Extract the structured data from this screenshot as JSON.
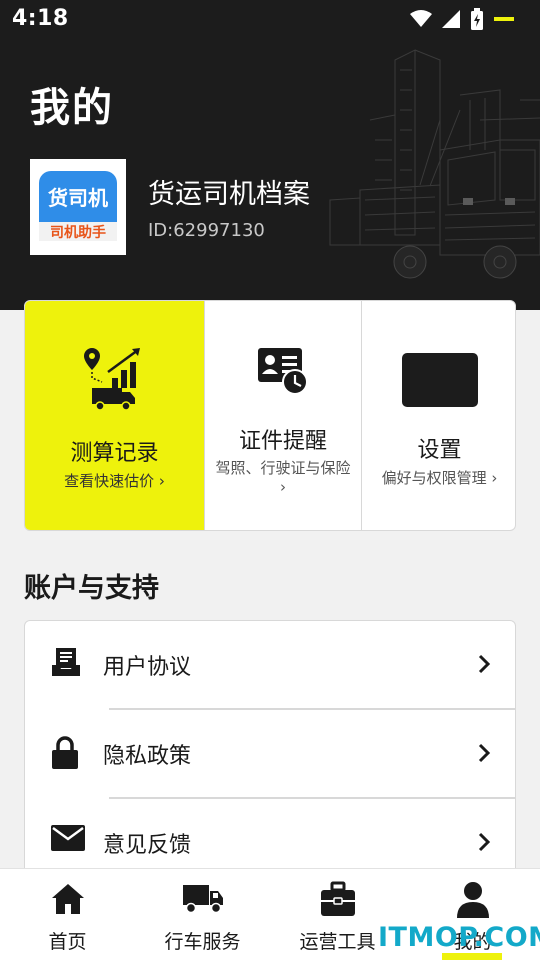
{
  "status_bar": {
    "time": "4:18"
  },
  "header": {
    "title": "我的",
    "profile": {
      "name": "货运司机档案",
      "id": "ID:62997130",
      "logo_text_top": "货司机",
      "logo_text_bottom": "司机助手"
    }
  },
  "cards": [
    {
      "title": "测算记录",
      "subtitle": "查看快速估价 ›",
      "icon": "route-chart-truck-icon",
      "accent": "#eef20c"
    },
    {
      "title": "证件提醒",
      "subtitle": "驾照、行驶证与保险 ›",
      "icon": "id-card-clock-icon"
    },
    {
      "title": "设置",
      "subtitle": "偏好与权限管理 ›",
      "icon": "settings-placeholder-icon"
    }
  ],
  "section": {
    "title": "账户与支持",
    "items": [
      {
        "label": "用户协议",
        "icon": "document-tray-icon"
      },
      {
        "label": "隐私政策",
        "icon": "lock-icon"
      },
      {
        "label": "意见反馈",
        "icon": "mail-icon"
      }
    ]
  },
  "bottom_nav": [
    {
      "label": "首页",
      "icon": "home-icon"
    },
    {
      "label": "行车服务",
      "icon": "truck-icon"
    },
    {
      "label": "运营工具",
      "icon": "toolbox-icon"
    },
    {
      "label": "我的",
      "icon": "person-icon",
      "active": true
    }
  ],
  "watermark": "ITMOP.COM",
  "colors": {
    "accent": "#eef20c",
    "header_bg": "#1c1c1c",
    "watermark": "#13a9c9"
  }
}
